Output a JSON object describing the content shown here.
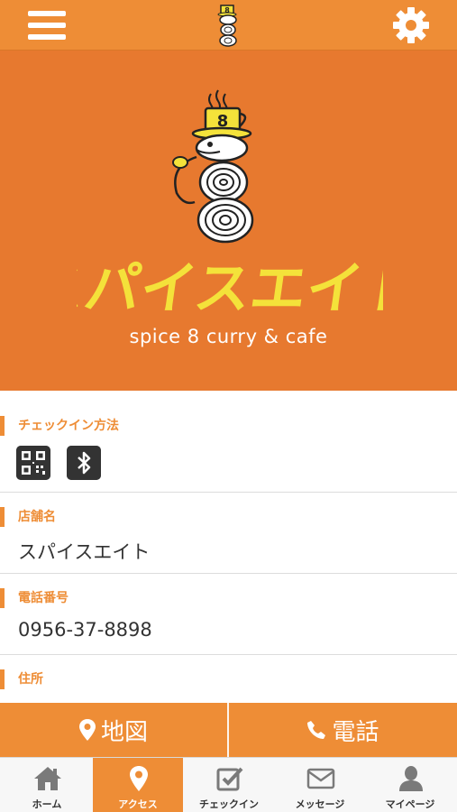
{
  "header": {
    "menu_icon": "hamburger-menu-icon",
    "logo_icon": "spice8-mascot-logo",
    "settings_icon": "gear-icon"
  },
  "hero": {
    "title": "スパイスエイト",
    "subtitle": "spice 8 curry & cafe",
    "cup_label": "8",
    "background": "#e7792f",
    "title_color": "#f4e23a"
  },
  "sections": {
    "checkin": {
      "label": "チェックイン方法",
      "icons": [
        "qr-code-icon",
        "bluetooth-icon"
      ]
    },
    "store_name": {
      "label": "店舗名",
      "value": "スパイスエイト"
    },
    "phone": {
      "label": "電話番号",
      "value": "0956-37-8898"
    },
    "address": {
      "label": "住所"
    }
  },
  "actions": {
    "map_label": "地図",
    "call_label": "電話"
  },
  "tabs": [
    {
      "label": "ホーム",
      "icon": "home-icon"
    },
    {
      "label": "アクセス",
      "icon": "map-pin-icon",
      "active": true
    },
    {
      "label": "チェックイン",
      "icon": "checkin-icon"
    },
    {
      "label": "メッセージ",
      "icon": "envelope-icon"
    },
    {
      "label": "マイページ",
      "icon": "user-icon"
    }
  ],
  "colors": {
    "accent": "#ee8d36",
    "label": "#ee8d36",
    "text": "#333333"
  }
}
